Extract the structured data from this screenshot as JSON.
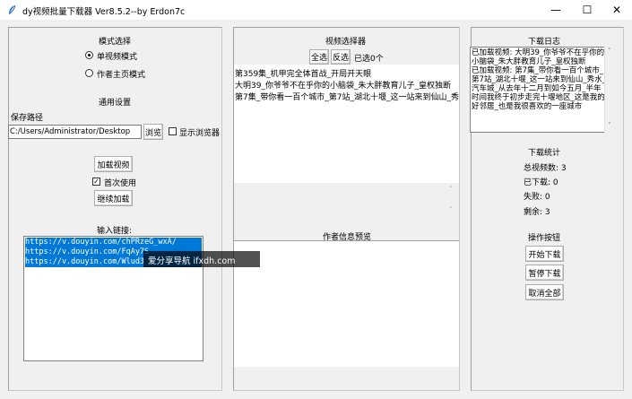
{
  "window": {
    "title": "dy视频批量下载器 Ver8.5.2--by Erdon7c",
    "minimize": "—",
    "maximize": "☐",
    "close": "✕"
  },
  "left": {
    "mode_title": "模式选择",
    "mode_single": "单视频模式",
    "mode_author": "作者主页模式",
    "general_settings": "通用设置",
    "save_path_label": "保存路径",
    "save_path_value": "C:/Users/Administrator/Desktop",
    "browse_button": "浏览",
    "show_browser": "显示浏览器",
    "load_video_button": "加载视频",
    "first_use": "首次使用",
    "continue_load_button": "继续加载",
    "input_label": "输入链接:",
    "links": [
      "https://v.douyin.com/chPRzeG_wxA/",
      "https://v.douyin.com/FqAy7S",
      "https://v.douyin.com/Wlud3"
    ]
  },
  "middle": {
    "selector_title": "视频选择器",
    "select_all": "全选",
    "invert": "反选",
    "selected_count": "已选0个",
    "videos": [
      "第359集_机甲完全体首战_开局开天眼",
      "大明39_你爷爷不在乎你的小脑袋_朱大胖教育儿子_皇权独断",
      "第7集_带你看一百个城市_第7站_湖北十堰_这一站来到仙山_秀水_汽"
    ],
    "author_preview_title": "作者信息预览"
  },
  "right": {
    "log_title": "下载日志",
    "log_text": "已加载视频: 大明39_你爷爷不在乎你的小脑袋_朱大胖教育儿子_皇权独断\n已加载视频: 第7集_带你看一百个城市_第7站_湖北十堰_这一站来到仙山_秀水_汽车城_从去年十二月到如今五月_半年时间我终于初步走完十堰地区_这是我的好邻居_也是我很喜欢的一座城市",
    "stats_title": "下载统计",
    "total": "总视频数: 3",
    "downloaded": "已下载: 0",
    "failed": "失败: 0",
    "remaining": "剩余: 3",
    "ops_title": "操作按钮",
    "start_button": "开始下载",
    "pause_button": "暂停下载",
    "cancel_button": "取消全部"
  },
  "watermark": {
    "text": "爱分享导航 ifxdh.com"
  }
}
